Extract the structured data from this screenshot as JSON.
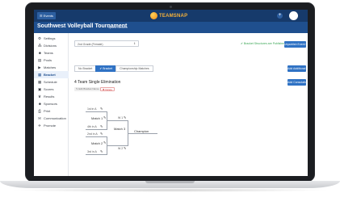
{
  "brand": {
    "name": "TEAMSNAP",
    "color": "#f6b23a"
  },
  "topbar": {
    "events_label": "☰ Events",
    "plus_label": "+"
  },
  "tournament": {
    "title": "Southwest Volleyball Tournament",
    "subtitle": "Sports Network"
  },
  "sidebar": {
    "items": [
      {
        "label": "Settings",
        "icon": "gear-icon"
      },
      {
        "label": "Divisions",
        "icon": "sitemap-icon"
      },
      {
        "label": "Teams",
        "icon": "people-icon"
      },
      {
        "label": "Pools",
        "icon": "document-icon"
      },
      {
        "label": "Matches",
        "icon": "play-icon"
      },
      {
        "label": "Bracket",
        "icon": "bracket-icon",
        "active": true
      },
      {
        "label": "Schedule",
        "icon": "calendar-icon"
      },
      {
        "label": "Scores",
        "icon": "scoreboard-icon"
      },
      {
        "label": "Results",
        "icon": "trophy-icon"
      },
      {
        "label": "Sponsors",
        "icon": "sponsor-icon"
      },
      {
        "label": "Print",
        "icon": "print-icon"
      },
      {
        "label": "Communication",
        "icon": "chat-icon"
      },
      {
        "label": "Promote",
        "icon": "megaphone-icon"
      }
    ]
  },
  "toolbar": {
    "division_select": "2nd Grade (Female)",
    "publish_status": "✔ Bracket Structures are Published",
    "unpublish_label": "Unpublish Event Brackets",
    "add_bracket_label": "Add Additional Bracket",
    "add_consolation_label": "Add Consolation Match"
  },
  "tabs": [
    {
      "label": "No Bracket",
      "active": false
    },
    {
      "label": "✔ Bracket",
      "active": true
    },
    {
      "label": "Championship Matches",
      "active": false
    }
  ],
  "bracket": {
    "title": "4 Team Single Elimination",
    "tag_build": "✎ Edit Bracket Name",
    "tag_delete": "✖ Delete",
    "seeds": [
      "1st in A",
      "4th in A",
      "2nd in A",
      "3rd in A"
    ],
    "matches": [
      "Match 1",
      "Match 2",
      "Match 3"
    ],
    "winners": [
      "W 1",
      "W 2"
    ],
    "champion": "Champion"
  }
}
